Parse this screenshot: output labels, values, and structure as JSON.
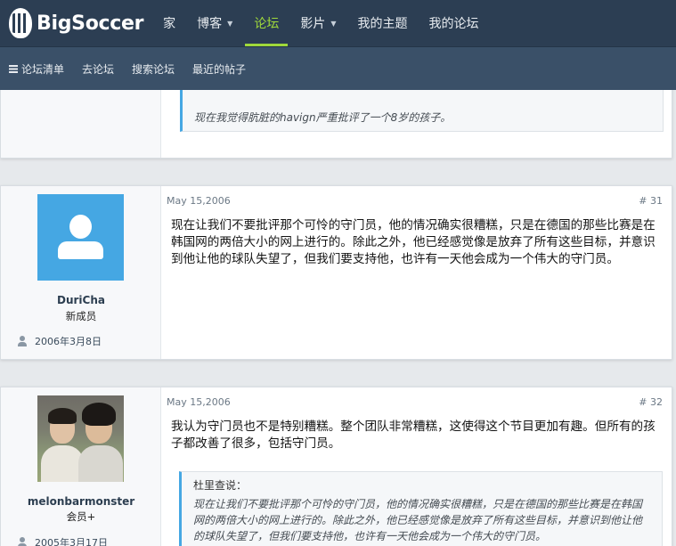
{
  "header": {
    "logo_text": "BigSoccer",
    "nav": [
      {
        "label": "家",
        "dropdown": false,
        "active": false
      },
      {
        "label": "博客",
        "dropdown": true,
        "active": false
      },
      {
        "label": "论坛",
        "dropdown": false,
        "active": true
      },
      {
        "label": "影片",
        "dropdown": true,
        "active": false
      },
      {
        "label": "我的主题",
        "dropdown": false,
        "active": false
      },
      {
        "label": "我的论坛",
        "dropdown": false,
        "active": false
      }
    ],
    "accent_color": "#9fd93b"
  },
  "subnav": {
    "items": [
      "论坛清单",
      "去论坛",
      "搜索论坛",
      "最近的帖子"
    ]
  },
  "prev_post": {
    "quote_text": "现在我觉得肮脏的havign严重批评了一个8岁的孩子。"
  },
  "posts": [
    {
      "username": "DuriCha",
      "user_title": "新成员",
      "join_date": "2006年3月8日",
      "avatar": "default-avatar",
      "date": "May 15,2006",
      "number": "# 31",
      "text": "现在让我们不要批评那个可怜的守门员，他的情况确实很糟糕，只是在德国的那些比赛是在韩国网的两倍大小的网上进行的。除此之外，他已经感觉像是放弃了所有这些目标，并意识到他让他的球队失望了，但我们要支持他，也许有一天他会成为一个伟大的守门员。"
    },
    {
      "username": "melonbarmonster",
      "user_title": "会员+",
      "join_date": "2005年3月17日",
      "avatar": "photo-avatar",
      "date": "May 15,2006",
      "number": "# 32",
      "text": "我认为守门员也不是特别糟糕。整个团队非常糟糕，这使得这个节目更加有趣。但所有的孩子都改善了很多，包括守门员。",
      "quote": {
        "author": "杜里查说：",
        "text": "现在让我们不要批评那个可怜的守门员，他的情况确实很糟糕，只是在德国的那些比赛是在韩国网的两倍大小的网上进行的。除此之外，他已经感觉像是放弃了所有这些目标，并意识到他让他的球队失望了，但我们要支持他，也许有一天他会成为一个伟大的守门员。"
      }
    }
  ]
}
